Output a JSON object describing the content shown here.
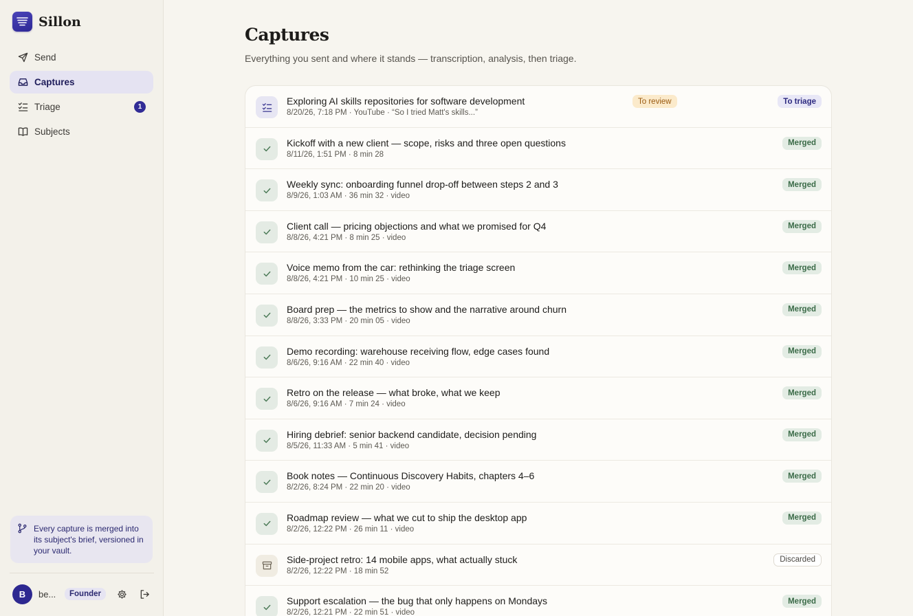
{
  "app": {
    "name": "Sillon",
    "accent": "#312c96"
  },
  "sidebar": {
    "items": [
      {
        "label": "Send",
        "icon": "send-icon",
        "active": false
      },
      {
        "label": "Captures",
        "icon": "inbox-icon",
        "active": true
      },
      {
        "label": "Triage",
        "icon": "checklist-icon",
        "active": false,
        "badge": "1"
      },
      {
        "label": "Subjects",
        "icon": "book-icon",
        "active": false
      }
    ],
    "info_card": {
      "icon": "git-branch-icon",
      "text": "Every capture is merged into its subject's brief, versioned in your vault."
    },
    "user": {
      "initial": "B",
      "name": "be...",
      "role": "Founder"
    }
  },
  "page": {
    "title": "Captures",
    "subtitle": "Everything you sent and where it stands — transcription, analysis, then triage."
  },
  "captures": [
    {
      "title": "Exploring AI skills repositories for software development",
      "meta": "8/20/26, 7:18 PM · YouTube · “So I tried Matt's skills...”",
      "status": "To triage",
      "status_type": "totriage",
      "icon": "checklist-icon",
      "review": "To review"
    },
    {
      "title": "Kickoff with a new client — scope, risks and three open questions",
      "meta": "8/11/26, 1:51 PM · 8 min 28",
      "status": "Merged",
      "status_type": "merged",
      "icon": "check-icon"
    },
    {
      "title": "Weekly sync: onboarding funnel drop-off between steps 2 and 3",
      "meta": "8/9/26, 1:03 AM · 36 min 32 · video",
      "status": "Merged",
      "status_type": "merged",
      "icon": "check-icon"
    },
    {
      "title": "Client call — pricing objections and what we promised for Q4",
      "meta": "8/8/26, 4:21 PM · 8 min 25 · video",
      "status": "Merged",
      "status_type": "merged",
      "icon": "check-icon"
    },
    {
      "title": "Voice memo from the car: rethinking the triage screen",
      "meta": "8/8/26, 4:21 PM · 10 min 25 · video",
      "status": "Merged",
      "status_type": "merged",
      "icon": "check-icon"
    },
    {
      "title": "Board prep — the metrics to show and the narrative around churn",
      "meta": "8/8/26, 3:33 PM · 20 min 05 · video",
      "status": "Merged",
      "status_type": "merged",
      "icon": "check-icon"
    },
    {
      "title": "Demo recording: warehouse receiving flow, edge cases found",
      "meta": "8/6/26, 9:16 AM · 22 min 40 · video",
      "status": "Merged",
      "status_type": "merged",
      "icon": "check-icon"
    },
    {
      "title": "Retro on the release — what broke, what we keep",
      "meta": "8/6/26, 9:16 AM · 7 min 24 · video",
      "status": "Merged",
      "status_type": "merged",
      "icon": "check-icon"
    },
    {
      "title": "Hiring debrief: senior backend candidate, decision pending",
      "meta": "8/5/26, 11:33 AM · 5 min 41 · video",
      "status": "Merged",
      "status_type": "merged",
      "icon": "check-icon"
    },
    {
      "title": "Book notes — Continuous Discovery Habits, chapters 4–6",
      "meta": "8/2/26, 8:24 PM · 22 min 20 · video",
      "status": "Merged",
      "status_type": "merged",
      "icon": "check-icon"
    },
    {
      "title": "Roadmap review — what we cut to ship the desktop app",
      "meta": "8/2/26, 12:22 PM · 26 min 11 · video",
      "status": "Merged",
      "status_type": "merged",
      "icon": "check-icon"
    },
    {
      "title": "Side-project retro: 14 mobile apps, what actually stuck",
      "meta": "8/2/26, 12:22 PM · 18 min 52",
      "status": "Discarded",
      "status_type": "discarded",
      "icon": "archive-icon"
    },
    {
      "title": "Support escalation — the bug that only happens on Mondays",
      "meta": "8/2/26, 12:21 PM · 22 min 51 · video",
      "status": "Merged",
      "status_type": "merged",
      "icon": "check-icon"
    }
  ]
}
